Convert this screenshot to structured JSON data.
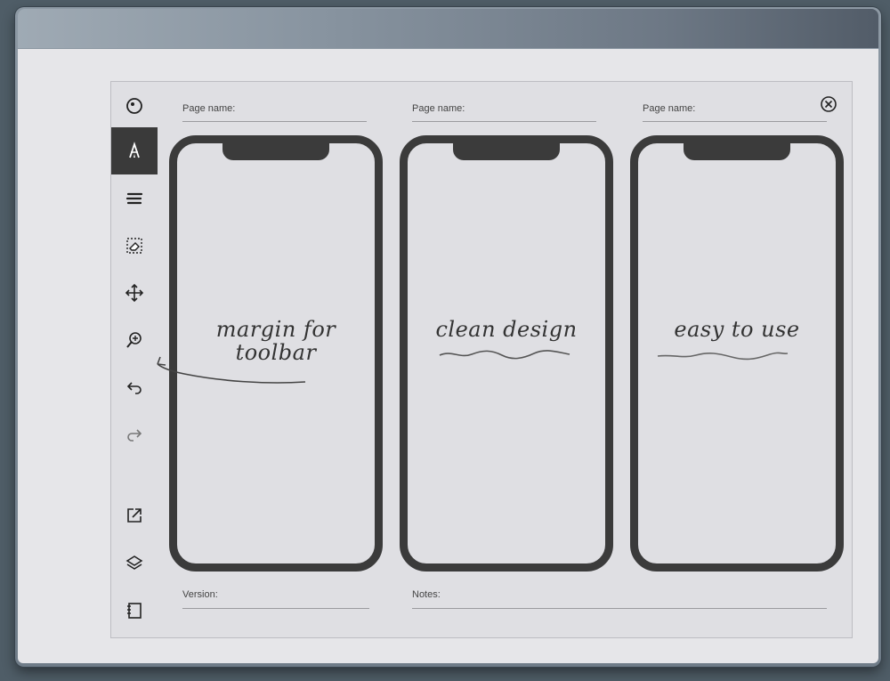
{
  "form": {
    "page_name_label": "Page name:",
    "version_label": "Version:",
    "notes_label": "Notes:"
  },
  "toolbar": {
    "items": [
      {
        "name": "pen-menu-icon"
      },
      {
        "name": "marker-icon",
        "active": true
      },
      {
        "name": "brush-stroke-icon"
      },
      {
        "name": "eraser-selection-icon"
      },
      {
        "name": "move-icon"
      },
      {
        "name": "zoom-icon"
      },
      {
        "name": "undo-icon"
      },
      {
        "name": "redo-icon"
      },
      {
        "name": "share-icon"
      },
      {
        "name": "layers-icon"
      },
      {
        "name": "notebook-icon"
      }
    ]
  },
  "phones": [
    {
      "note_lines": [
        "margin for",
        "toolbar"
      ]
    },
    {
      "note_lines": [
        "clean design"
      ]
    },
    {
      "note_lines": [
        "easy to use"
      ]
    }
  ],
  "colors": {
    "frame_dark": "#3b3b3b",
    "screen": "#e6e6e9",
    "active_tool": "#3a3a3a"
  }
}
